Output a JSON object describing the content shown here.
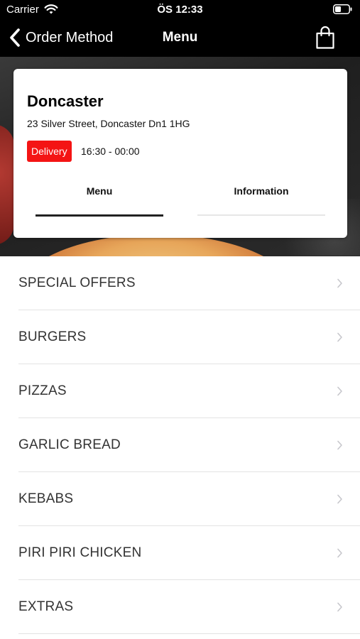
{
  "status_bar": {
    "carrier": "Carrier",
    "time": "ÖS 12:33"
  },
  "nav": {
    "back_label": "Order Method",
    "title": "Menu",
    "icons": [
      "chevron-left-icon",
      "shopping-bag-icon"
    ]
  },
  "store": {
    "name": "Doncaster",
    "address": "23 Silver Street, Doncaster Dn1 1HG",
    "badge": "Delivery",
    "hours": "16:30 - 00:00",
    "tabs": [
      {
        "label": "Menu",
        "active": true
      },
      {
        "label": "Information",
        "active": false
      }
    ]
  },
  "categories": [
    {
      "label": "SPECIAL OFFERS"
    },
    {
      "label": "BURGERS"
    },
    {
      "label": "PIZZAS"
    },
    {
      "label": "GARLIC BREAD"
    },
    {
      "label": "KEBABS"
    },
    {
      "label": "PIRI PIRI CHICKEN"
    },
    {
      "label": "EXTRAS"
    }
  ],
  "colors": {
    "bar_background": "#000000",
    "delivery_badge": "#f41414",
    "active_tab_underline": "#222222",
    "row_divider": "#e3e3e3"
  }
}
